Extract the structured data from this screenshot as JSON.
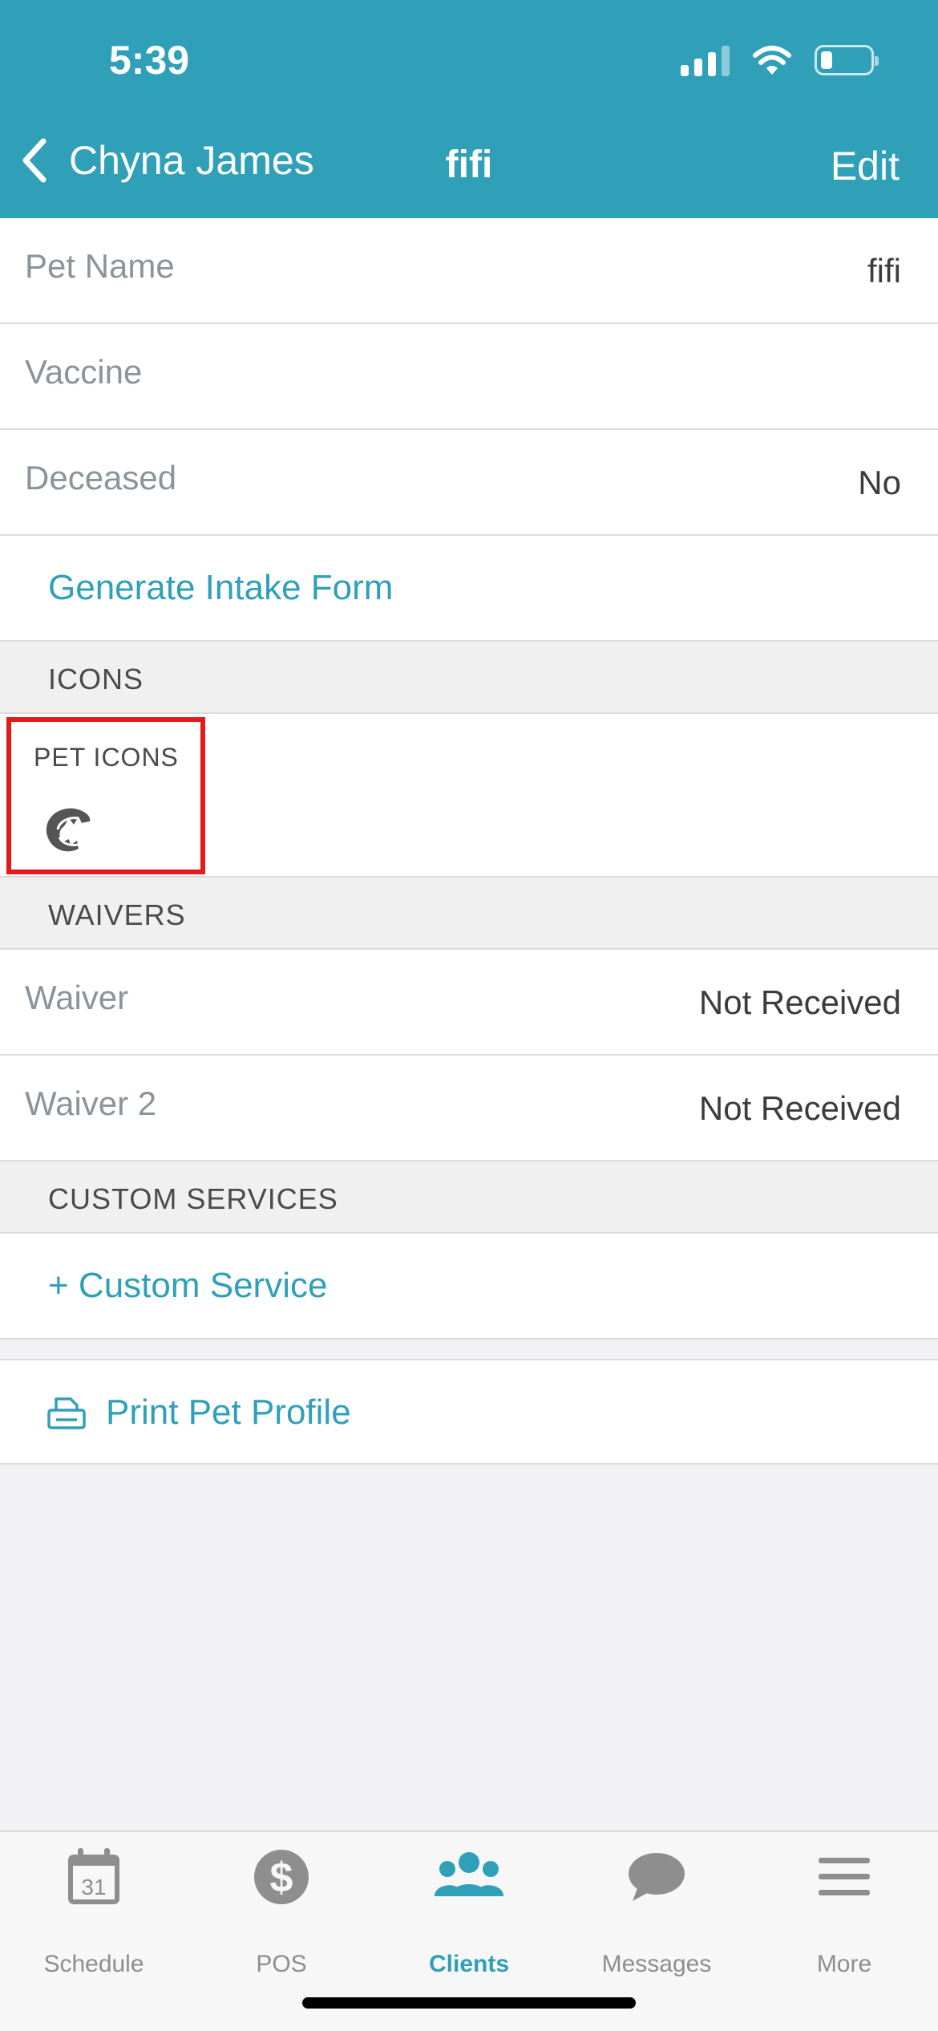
{
  "status_bar": {
    "time": "5:39"
  },
  "nav": {
    "back_label": "Chyna James",
    "title": "fifi",
    "edit_label": "Edit"
  },
  "details": {
    "pet_name_label": "Pet Name",
    "pet_name_value": "fifi",
    "vaccine_label": "Vaccine",
    "deceased_label": "Deceased",
    "deceased_value": "No",
    "intake_form_label": "Generate Intake Form"
  },
  "icons_section": {
    "header": "ICONS",
    "pet_icons_label": "PET ICONS",
    "pet_icon": "dog-bite-icon"
  },
  "waivers_section": {
    "header": "WAIVERS",
    "items": [
      {
        "label": "Waiver",
        "value": "Not Received"
      },
      {
        "label": "Waiver 2",
        "value": "Not Received"
      }
    ]
  },
  "custom_services": {
    "header": "CUSTOM SERVICES",
    "add_label": "+ Custom Service"
  },
  "print": {
    "label": "Print Pet Profile",
    "icon": "printer-icon"
  },
  "tabbar": {
    "tabs": [
      {
        "label": "Schedule",
        "icon": "calendar-icon",
        "calendar_day": "31"
      },
      {
        "label": "POS",
        "icon": "dollar-icon",
        "glyph": "$"
      },
      {
        "label": "Clients",
        "icon": "clients-icon",
        "active": true
      },
      {
        "label": "Messages",
        "icon": "chat-bubble-icon"
      },
      {
        "label": "More",
        "icon": "menu-icon"
      }
    ]
  },
  "colors": {
    "accent": "#2fa0b8",
    "highlight": "#e41b1b",
    "muted_text": "#8a949b"
  }
}
